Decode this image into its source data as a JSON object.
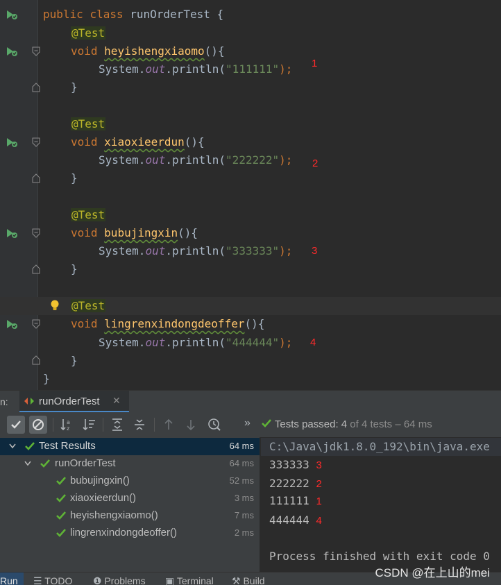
{
  "editor": {
    "class_header": {
      "kw1": "public",
      "kw2": "class",
      "name": "runOrderTest",
      "brace": " {"
    },
    "methods": [
      {
        "annotation": "@Test",
        "kw": "void",
        "name": "heyishengxiaomo",
        "params": "(){",
        "obj": "System.",
        "field": "out",
        "call": ".println(",
        "arg": "\"111111\"",
        "end": ");",
        "close": "}",
        "mark": "1"
      },
      {
        "annotation": "@Test",
        "kw": "void",
        "name": "xiaoxieerdun",
        "params": "(){",
        "obj": "System.",
        "field": "out",
        "call": ".println(",
        "arg": "\"222222\"",
        "end": ");",
        "close": "}",
        "mark": "2"
      },
      {
        "annotation": "@Test",
        "kw": "void",
        "name": "bubujingxin",
        "params": "(){",
        "obj": "System.",
        "field": "out",
        "call": ".println(",
        "arg": "\"333333\"",
        "end": ");",
        "close": "}",
        "mark": "3"
      },
      {
        "annotation": "@Test",
        "kw": "void",
        "name": "lingrenxindongdeoffer",
        "params": "(){",
        "obj": "System.",
        "field": "out",
        "call": ".println(",
        "arg": "\"444444\"",
        "end": ");",
        "close": "}",
        "mark": "4"
      }
    ],
    "class_close": "}"
  },
  "run_panel": {
    "prefix": "n:",
    "tab_label": "runOrderTest",
    "tab_close": "✕",
    "status_prefix": "Tests passed: ",
    "status_count": "4",
    "status_suffix": " of 4 tests – 64 ms",
    "overflow": "»"
  },
  "test_tree": [
    {
      "label": "Test Results",
      "time": "64 ms"
    },
    {
      "label": "runOrderTest",
      "time": "64 ms"
    },
    {
      "label": "bubujingxin()",
      "time": "52 ms"
    },
    {
      "label": "xiaoxieerdun()",
      "time": "3 ms"
    },
    {
      "label": "heyishengxiaomo()",
      "time": "7 ms"
    },
    {
      "label": "lingrenxindongdeoffer()",
      "time": "2 ms"
    }
  ],
  "console": {
    "command": "C:\\Java\\jdk1.8.0_192\\bin\\java.exe",
    "lines": [
      {
        "text": "333333",
        "mark": "3"
      },
      {
        "text": "222222",
        "mark": "2"
      },
      {
        "text": "111111",
        "mark": "1"
      },
      {
        "text": "444444",
        "mark": "4"
      }
    ],
    "exit": "Process finished with exit code 0"
  },
  "bottom_tabs": [
    "Run",
    "TODO",
    "Problems",
    "Terminal",
    "Build"
  ],
  "watermark": "CSDN @在上山的mei",
  "colors": {
    "accent": "#4a88c7",
    "pass": "#5fb336",
    "mark": "#ff2b2b"
  }
}
